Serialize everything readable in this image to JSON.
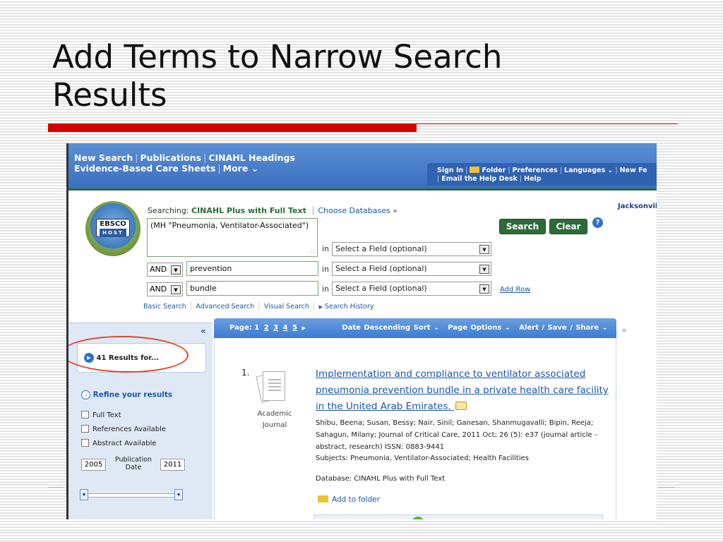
{
  "slide": {
    "title_line1": "Add Terms to Narrow Search",
    "title_line2": "Results"
  },
  "topnav": {
    "row1": [
      "New Search",
      "Publications",
      "CINAHL Headings"
    ],
    "row2": [
      "Evidence-Based Care Sheets",
      "More ⌄"
    ]
  },
  "toplinks": {
    "row1": [
      "Sign In",
      "Folder",
      "Preferences",
      "Languages ⌄",
      "New Fe"
    ],
    "row2": [
      "Email the Help Desk",
      "Help"
    ]
  },
  "logo": {
    "text": "EBSCO",
    "sub": "HOST"
  },
  "search": {
    "searching_label": "Searching:",
    "database": "CINAHL Plus with Full Text",
    "choose_databases": "Choose Databases »",
    "institution": "Jacksonvill",
    "in_label": "in",
    "row1": {
      "term": "(MH \"Pneumonia, Ventilator-Associated\")",
      "field": "Select a Field (optional)"
    },
    "row2": {
      "bool": "AND",
      "term": "prevention",
      "field": "Select a Field (optional)"
    },
    "row3": {
      "bool": "AND",
      "term": "bundle",
      "field": "Select a Field (optional)"
    },
    "search_button": "Search",
    "clear_button": "Clear",
    "add_row": "Add Row",
    "links": [
      "Basic Search",
      "Advanced Search",
      "Visual Search",
      "Search History"
    ]
  },
  "sidebar": {
    "results_for": "41 Results for...",
    "refine": "Refine your results",
    "checkboxes": [
      "Full Text",
      "References Available",
      "Abstract Available"
    ],
    "year_from": "2005",
    "year_to": "2011",
    "pub_date_label": "Publication Date"
  },
  "toolbar": {
    "page_label": "Page:",
    "pages": [
      "1",
      "2",
      "3",
      "4",
      "5"
    ],
    "sort": "Date Descending Sort ⌄",
    "page_options": "Page Options ⌄",
    "alert": "Alert / Save / Share ⌄"
  },
  "result": {
    "number": "1.",
    "type_line1": "Academic",
    "type_line2": "Journal",
    "title": "Implementation and compliance to ventilator associated pneumonia prevention bundle in a private health care facility in the United Arab Emirates.",
    "meta": "Shibu, Beena; Susan, Bessy; Nair, Sinil; Ganesan, Shanmugavalli; Bipin, Reeja; Sahagun, Milany; Journal of Critical Care, 2011 Oct; 26 (5): e37 (journal article - abstract, research) ISSN: 0883-9441",
    "subjects": "Subjects: Pneumonia, Ventilator-Associated; Health Facilities",
    "database": "Database: CINAHL Plus with Full Text",
    "add_to_folder": "Add to folder"
  },
  "colors": {
    "accent_red": "#d40000",
    "ebsco_blue": "#3a6fc0",
    "ebsco_green": "#2e6b3a",
    "link_blue": "#1a56b0"
  }
}
